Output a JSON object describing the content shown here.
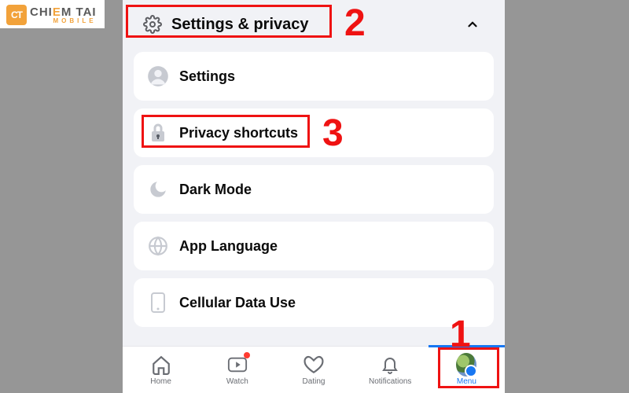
{
  "watermark": {
    "badge": "CT",
    "brand_pre": "CHI",
    "brand_accent": "E",
    "brand_post": "M TAI",
    "sub": "MOBILE"
  },
  "header": {
    "title": "Settings & privacy"
  },
  "items": [
    {
      "label": "Settings"
    },
    {
      "label": "Privacy shortcuts"
    },
    {
      "label": "Dark Mode"
    },
    {
      "label": "App Language"
    },
    {
      "label": "Cellular Data Use"
    }
  ],
  "tabs": [
    {
      "label": "Home"
    },
    {
      "label": "Watch"
    },
    {
      "label": "Dating"
    },
    {
      "label": "Notifications"
    },
    {
      "label": "Menu"
    }
  ],
  "annotations": {
    "n1": "1",
    "n2": "2",
    "n3": "3"
  },
  "colors": {
    "accent": "#1877f2",
    "annot": "#ef1212"
  }
}
